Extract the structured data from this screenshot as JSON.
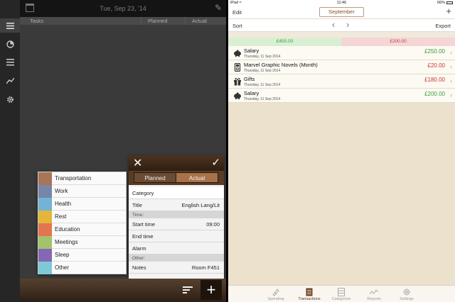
{
  "left_app": {
    "header": {
      "date": "Tue, Sep 23, '14"
    },
    "columns": [
      "Tasks",
      "Planned",
      "Actual"
    ],
    "categories": [
      {
        "label": "Transportation",
        "color": "#a87558"
      },
      {
        "label": "Work",
        "color": "#7786a8"
      },
      {
        "label": "Health",
        "color": "#72b3d6"
      },
      {
        "label": "Rest",
        "color": "#e3b63a"
      },
      {
        "label": "Education",
        "color": "#e2754e"
      },
      {
        "label": "Meetings",
        "color": "#a2c36a"
      },
      {
        "label": "Sleep",
        "color": "#8667b5"
      },
      {
        "label": "Other",
        "color": "#7ec8d8"
      }
    ],
    "detail": {
      "segments": {
        "planned": "Planned",
        "actual": "Actual"
      },
      "rows": {
        "category": "Category",
        "title_label": "Title",
        "title_value": "English Lang/Lit",
        "time_section": "Time:",
        "start_label": "Start time",
        "start_value": "09:00",
        "end_label": "End time",
        "alarm_label": "Alarm",
        "other_section": "Other:",
        "notes_label": "Notes",
        "notes_value": "Room F451"
      }
    }
  },
  "right_app": {
    "status": {
      "device": "iPad ≈",
      "time": "11:46",
      "battery": "66%"
    },
    "nav": {
      "edit": "Edit",
      "month": "September"
    },
    "toolbar": {
      "sort": "Sort",
      "export": "Export"
    },
    "totals": {
      "income": "£450.00",
      "expense": "£200.00"
    },
    "transactions": [
      {
        "title": "Salary",
        "date": "Thursday, 11 Sep 2014",
        "amount": "£250.00",
        "sign": "pos",
        "icon": "piggy-bank-icon"
      },
      {
        "title": "Marvel Graphic Novels (Month)",
        "date": "Thursday, 11 Sep 2014",
        "amount": "£20.00",
        "sign": "neg",
        "icon": "ipod-icon"
      },
      {
        "title": "Gifts",
        "date": "Thursday, 11 Sep 2014",
        "amount": "£180.00",
        "sign": "neg",
        "icon": "gift-icon"
      },
      {
        "title": "Salary",
        "date": "Thursday, 11 Sep 2014",
        "amount": "£200.00",
        "sign": "pos",
        "icon": "piggy-bank-icon"
      }
    ],
    "tabs": [
      {
        "label": "Spending",
        "icon": "spending-icon"
      },
      {
        "label": "Transactions",
        "icon": "transactions-icon"
      },
      {
        "label": "Categories",
        "icon": "categories-icon"
      },
      {
        "label": "Reports",
        "icon": "reports-icon"
      },
      {
        "label": "Settings",
        "icon": "settings-icon"
      }
    ],
    "active_tab": "Transactions"
  }
}
